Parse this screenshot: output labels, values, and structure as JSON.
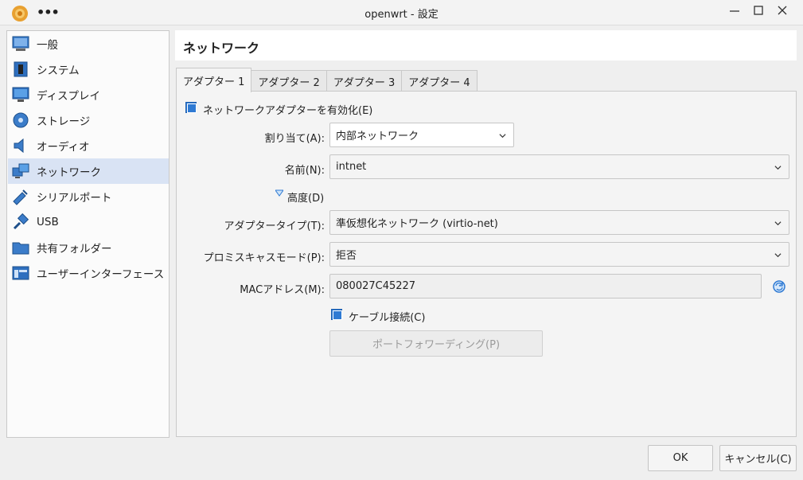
{
  "window": {
    "title": "openwrt - 設定",
    "menu": "•••"
  },
  "sidebar": {
    "items": [
      {
        "label": "一般",
        "icon": "general-icon"
      },
      {
        "label": "システム",
        "icon": "system-icon"
      },
      {
        "label": "ディスプレイ",
        "icon": "display-icon"
      },
      {
        "label": "ストレージ",
        "icon": "storage-icon"
      },
      {
        "label": "オーディオ",
        "icon": "audio-icon"
      },
      {
        "label": "ネットワーク",
        "icon": "network-icon"
      },
      {
        "label": "シリアルポート",
        "icon": "serial-port-icon"
      },
      {
        "label": "USB",
        "icon": "usb-icon"
      },
      {
        "label": "共有フォルダー",
        "icon": "shared-folder-icon"
      },
      {
        "label": "ユーザーインターフェース",
        "icon": "user-interface-icon"
      }
    ],
    "selected_index": 5
  },
  "page": {
    "title": "ネットワーク"
  },
  "tabs": [
    {
      "label": "アダプター 1",
      "active": true
    },
    {
      "label": "アダプター 2",
      "active": false
    },
    {
      "label": "アダプター 3",
      "active": false
    },
    {
      "label": "アダプター 4",
      "active": false
    }
  ],
  "adapter": {
    "enable_label": "ネットワークアダプターを有効化(E)",
    "enable_checked": true,
    "attached_label": "割り当て(A):",
    "attached_value": "内部ネットワーク",
    "name_label": "名前(N):",
    "name_value": "intnet",
    "advanced_label": "高度(D)",
    "adapter_type_label": "アダプタータイプ(T):",
    "adapter_type_value": "準仮想化ネットワーク (virtio-net)",
    "promisc_label": "プロミスキャスモード(P):",
    "promisc_value": "拒否",
    "mac_label": "MACアドレス(M):",
    "mac_value": "080027C45227",
    "cable_label": "ケーブル接続(C)",
    "cable_checked": true,
    "port_forwarding_label": "ポートフォワーディング(P)"
  },
  "footer": {
    "ok_label": "OK",
    "cancel_label": "キャンセル(C)"
  },
  "colors": {
    "accent": "#2f7ad3",
    "selected_bg": "#d9e3f4"
  }
}
